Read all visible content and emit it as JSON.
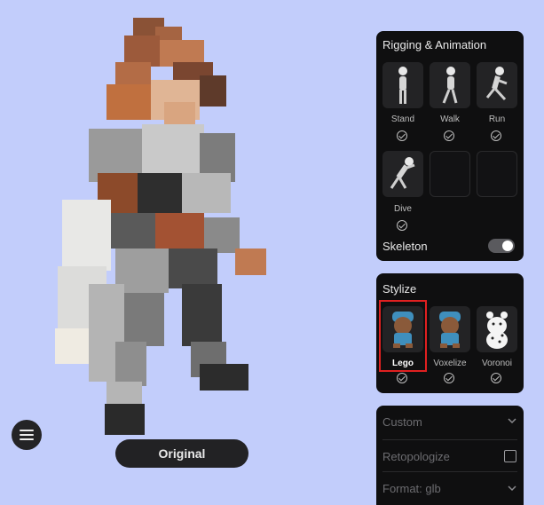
{
  "rigging": {
    "title": "Rigging & Animation",
    "animations": [
      {
        "label": "Stand",
        "icon": "standing-figure-icon"
      },
      {
        "label": "Walk",
        "icon": "walking-figure-icon"
      },
      {
        "label": "Run",
        "icon": "running-figure-icon"
      },
      {
        "label": "Dive",
        "icon": "diving-figure-icon"
      }
    ],
    "skeleton_label": "Skeleton",
    "skeleton_on": true
  },
  "stylize": {
    "title": "Stylize",
    "options": [
      {
        "label": "Lego",
        "selected": true,
        "icon": "lego-bear-icon"
      },
      {
        "label": "Voxelize",
        "selected": false,
        "icon": "voxel-bear-icon"
      },
      {
        "label": "Voronoi",
        "selected": false,
        "icon": "voronoi-bear-icon"
      }
    ],
    "highlight_color": "#e02020"
  },
  "settings": {
    "custom_label": "Custom",
    "retopologize_label": "Retopologize",
    "format_label": "Format: glb"
  },
  "viewport": {
    "original_button": "Original",
    "model_icon": "lego-character-model"
  },
  "colors": {
    "background": "#c2cdfb",
    "panel": "#0f0f10"
  }
}
